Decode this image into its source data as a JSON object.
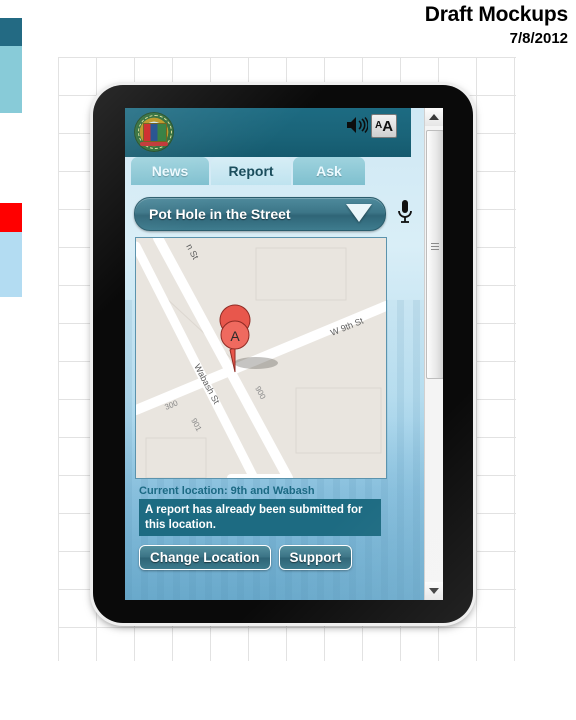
{
  "header": {
    "title": "Draft Mockups",
    "date": "7/8/2012"
  },
  "palette_swatches": [
    {
      "name": "dark-teal",
      "color": "#236a83"
    },
    {
      "name": "light-teal",
      "color": "#88cbd8"
    },
    {
      "name": "red",
      "color": "#ff0000"
    },
    {
      "name": "pale-blue",
      "color": "#b3dcf2"
    }
  ],
  "app": {
    "logo_name": "city-seal",
    "toolbar": {
      "speaker_icon": "speaker-icon",
      "text_size_icon": "text-size-icon",
      "text_size_label_small": "A",
      "text_size_label_large": "A"
    },
    "tabs": [
      {
        "id": "news",
        "label": "News",
        "active": false
      },
      {
        "id": "report",
        "label": "Report",
        "active": true
      },
      {
        "id": "ask",
        "label": "Ask",
        "active": false
      }
    ],
    "category_select": {
      "value": "Pot Hole in the Street",
      "caret_icon": "chevron-down-icon"
    },
    "voice_input_icon": "microphone-icon",
    "map": {
      "marker_label": "A",
      "streets": [
        {
          "name": "W 9th St"
        },
        {
          "name": "Wabash St"
        },
        {
          "name": "n St"
        }
      ],
      "address_numbers": [
        "300",
        "901",
        "900"
      ]
    },
    "current_location": "Current location: 9th and Wabash",
    "alert_message": "A report has already been submitted for this location.",
    "buttons": [
      {
        "id": "change-location",
        "label": "Change Location"
      },
      {
        "id": "support",
        "label": "Support"
      }
    ],
    "scrollbar": {
      "up_icon": "triangle-up-icon",
      "down_icon": "triangle-down-icon",
      "grip_icon": "grip-lines-icon"
    }
  },
  "colors": {
    "app_header": "#1d6b82",
    "accent": "#3c7688",
    "alert_bg": "#1d6b82",
    "marker": "#e8574c"
  }
}
